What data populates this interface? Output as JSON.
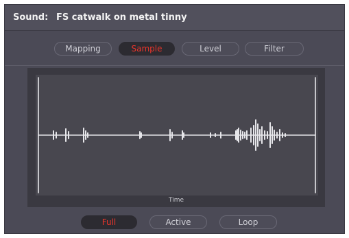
{
  "header": {
    "label": "Sound:",
    "value": "FS catwalk on metal tinny"
  },
  "tabs": [
    {
      "label": "Mapping",
      "active": false
    },
    {
      "label": "Sample",
      "active": true
    },
    {
      "label": "Level",
      "active": false
    },
    {
      "label": "Filter",
      "active": false
    }
  ],
  "waveform": {
    "axis_label": "Time"
  },
  "modes": [
    {
      "label": "Full",
      "active": true
    },
    {
      "label": "Active",
      "active": false
    },
    {
      "label": "Loop",
      "active": false
    }
  ],
  "colors": {
    "active_text": "#e8352b",
    "waveform": "#e6e6ea",
    "panel": "#4b4a56"
  }
}
